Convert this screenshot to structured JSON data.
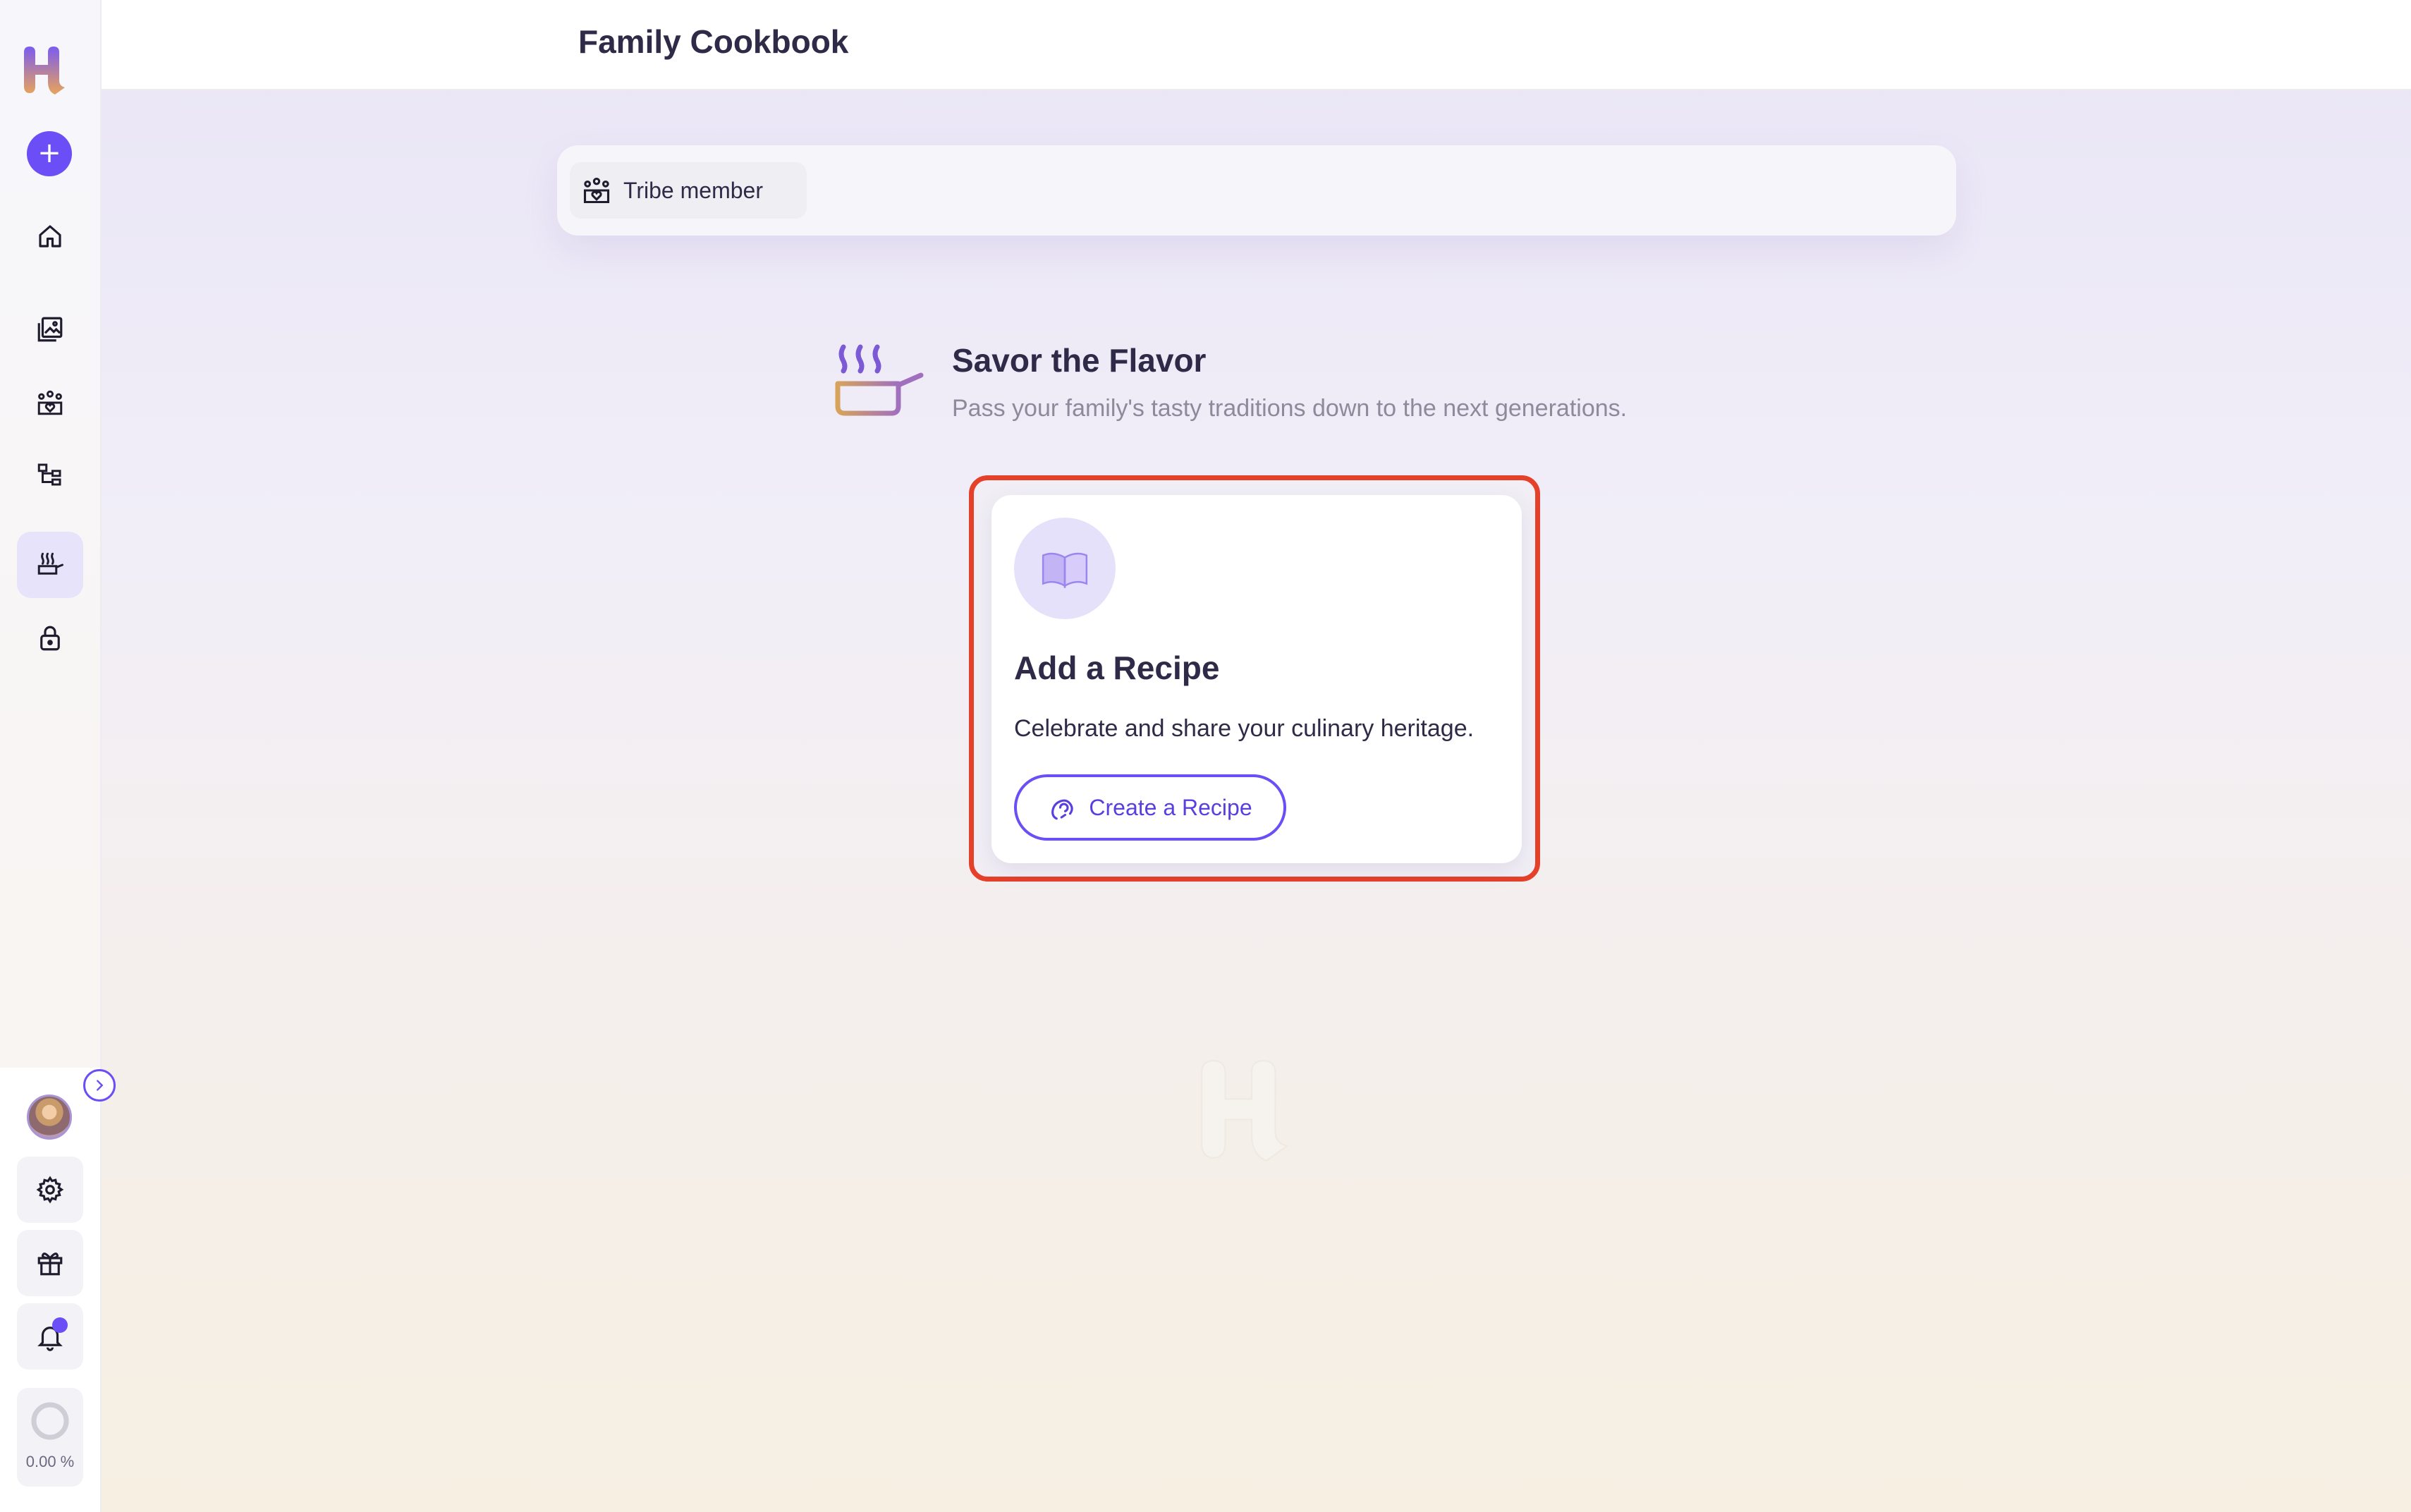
{
  "header": {
    "title": "Family Cookbook"
  },
  "filter": {
    "chip_label": "Tribe member"
  },
  "intro": {
    "title": "Savor the Flavor",
    "subtitle": "Pass your family's tasty traditions down to the next generations."
  },
  "card": {
    "title": "Add a Recipe",
    "description": "Celebrate and share your culinary heritage.",
    "button_label": "Create a Recipe"
  },
  "sidebar": {
    "add_label": "+",
    "items": [
      {
        "icon": "home-icon"
      },
      {
        "icon": "gallery-icon"
      },
      {
        "icon": "tribe-icon"
      },
      {
        "icon": "family-tree-icon"
      },
      {
        "icon": "cookbook-icon",
        "active": true
      },
      {
        "icon": "lock-icon"
      }
    ],
    "bottom": [
      {
        "icon": "gear-icon"
      },
      {
        "icon": "gift-icon"
      },
      {
        "icon": "bell-icon"
      }
    ],
    "progress_text": "0.00 %",
    "progress": 0
  },
  "colors": {
    "accent": "#6b4ef6",
    "highlight": "#e5402a"
  }
}
